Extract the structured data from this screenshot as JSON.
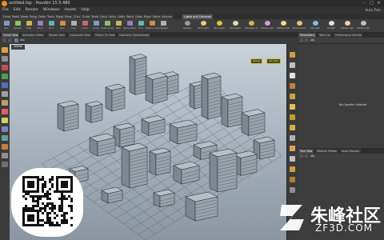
{
  "window": {
    "title": "untitled.hip - Houdini 15.5.480"
  },
  "menu": {
    "items": [
      "File",
      "Edit",
      "Render",
      "Windows",
      "Assets",
      "Help"
    ],
    "auto_label": "Auto Tem"
  },
  "shelf_tabs": [
    "Create",
    "Modify",
    "Model",
    "Polygon",
    "Deform",
    "Texture",
    "Rigging",
    "Muscles",
    "Char",
    "Guide Process",
    "Terrain FX",
    "Cloud FX",
    "Volume",
    "Lights and Cameras",
    "Collisions",
    "Particles",
    "Grains",
    "Rigid Bodies",
    "Particle Fluids",
    "Viscous"
  ],
  "create_tools": [
    "Box",
    "Sphere",
    "Tube",
    "Torus",
    "Grid",
    "Null",
    "Line",
    "Circle",
    "Curve",
    "Draw Curve",
    "Path",
    "Spray Paint",
    "Font",
    "Platonic Solids",
    "L-System"
  ],
  "light_tools": [
    "Camera",
    "Point Light",
    "Spot Light",
    "Area Light",
    "Geometry Light",
    "Volume Light",
    "Distant Light",
    "Environment Light",
    "Sky Light",
    "GI Light",
    "Caustic Light",
    "Portal Light"
  ],
  "pane_tabs": [
    "Scene View",
    "Animation Editor",
    "Render View",
    "Composite View",
    "Motion FX View",
    "Geometry Spreadsheet"
  ],
  "path": {
    "crumb": "obj"
  },
  "viewport": {
    "label": "View",
    "badge_persp": "persp",
    "badge_cam": "no cam"
  },
  "right_panel": {
    "top_tabs": [
      "Parameters",
      "Take List",
      "Performance Monitor"
    ],
    "crumb": "obj",
    "no_operator_text": "No Operator Selected",
    "bottom_tabs": [
      "Tree View",
      "Material Palette",
      "Asset Browser"
    ],
    "bottom_crumb": "obj"
  },
  "watermark": {
    "cn": "朱峰社区",
    "en": "ZF3D.COM"
  },
  "colors": {
    "accent_orange": "#f08a24",
    "viewport_top": "#c9d1d9",
    "viewport_bottom": "#8b96a1",
    "badge_yellow": "#d4d432"
  },
  "icons": {
    "left_tools": [
      "select-icon",
      "view-icon",
      "move-icon",
      "rotate-icon",
      "scale-icon",
      "handle-icon",
      "pose-icon",
      "paint-icon",
      "brush-icon",
      "render-icon",
      "camera-icon",
      "snap-icon",
      "grid-icon",
      "lock-icon"
    ],
    "right_tools": [
      "display-icon",
      "shading-icon",
      "wireframe-icon",
      "ghost-icon",
      "background-icon",
      "light-icon",
      "point-icon",
      "normal-icon",
      "uv-icon",
      "vector-icon",
      "info-icon",
      "particles-icon",
      "bounds-icon",
      "hidden-icon"
    ]
  }
}
